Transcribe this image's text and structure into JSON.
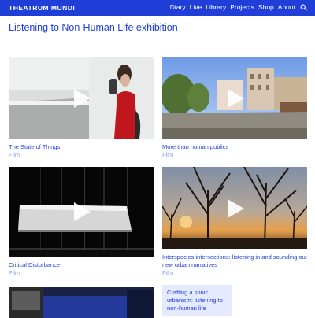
{
  "header": {
    "brand": "THEATRUM MUNDI",
    "nav": [
      "Diary",
      "Live",
      "Library",
      "Projects",
      "Shop",
      "About"
    ],
    "search_icon": "search-icon",
    "background": "#1f3fd8"
  },
  "page": {
    "title": "Listening to Non-Human Life exhibition"
  },
  "cards": [
    {
      "title": "The State of Things",
      "type": "Film",
      "icon": "play-icon"
    },
    {
      "title": "More than human publics",
      "type": "Film",
      "icon": "play-icon"
    },
    {
      "title": "Critical Disturbance",
      "type": "Film",
      "icon": "play-icon"
    },
    {
      "title": "Interspecies intersections: listening in and sounding out new urban narratives",
      "type": "Film",
      "icon": "play-icon"
    },
    {
      "title": "",
      "type": ""
    }
  ],
  "text_card": {
    "title": "Crafting a sonic urbanism: listening to non-human life",
    "background": "#e6eaff"
  },
  "colors": {
    "accent": "#1f3fd8",
    "muted": "#8ea0ef"
  }
}
